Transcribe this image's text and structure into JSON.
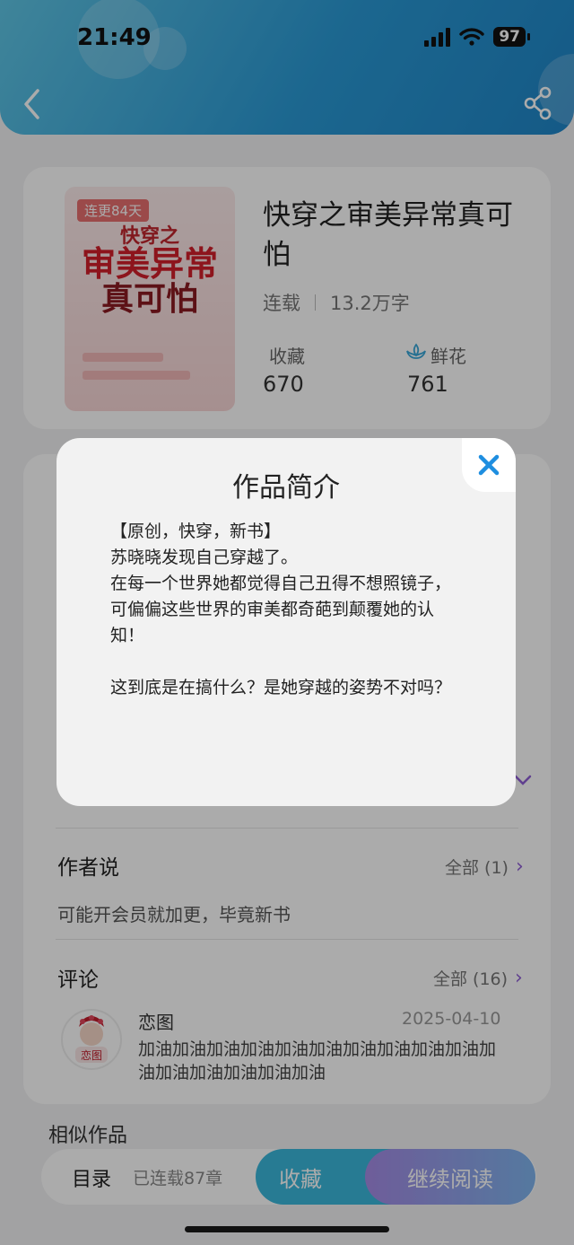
{
  "status_bar": {
    "time": "21:49",
    "battery": "97"
  },
  "book": {
    "cover_badge": "连更84天",
    "cover_title_line1": "快穿之",
    "cover_title_line2": "审美异常",
    "cover_title_line3": "真可怕",
    "title": "快穿之审美异常真可怕",
    "status": "连载",
    "word_count": "13.2万字",
    "stats": {
      "collect_label": "收藏",
      "collect_value": "670",
      "flower_label": "鲜花",
      "flower_value": "761"
    }
  },
  "author_says": {
    "title": "作者说",
    "more": "全部 (1)",
    "text": "可能开会员就加更，毕竟新书"
  },
  "comments": {
    "title": "评论",
    "more": "全部 (16)",
    "items": [
      {
        "user": "恋图",
        "date": "2025-04-10",
        "text": "加油加油加油加油加油加油加油加油加油加油加油加油加油加油加油加油"
      }
    ]
  },
  "similar_title": "相似作品",
  "bottom_bar": {
    "toc": "目录",
    "chapters": "已连载87章",
    "collect": "收藏",
    "read": "继续阅读"
  },
  "modal": {
    "title": "作品简介",
    "line1": "【原创，快穿，新书】",
    "line2": "苏晓晓发现自己穿越了。",
    "line3": "在每一个世界她都觉得自己丑得不想照镜子，可偏偏这些世界的审美都奇葩到颠覆她的认知！",
    "line4": "这到底是在搞什么？是她穿越的姿势不对吗？"
  },
  "colors": {
    "accent": "#2a9ad6",
    "close": "#1e8ee0",
    "purple": "#8f5fd6"
  }
}
